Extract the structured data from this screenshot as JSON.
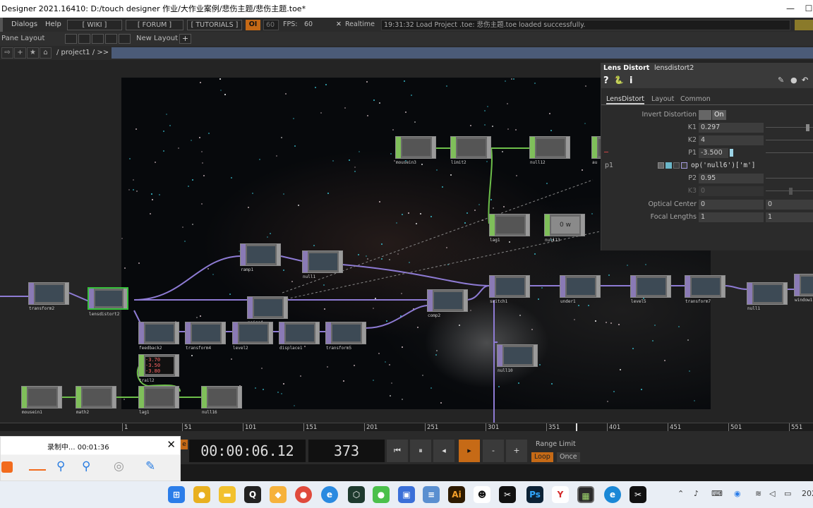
{
  "titlebar": {
    "title": "Designer 2021.16410: D:/touch designer 作业/大作业案例/悲伤主题/悲伤主题.toe*",
    "minimize": "—",
    "maximize": "☐"
  },
  "menubar": {
    "dialogs": "Dialogs",
    "help": "Help",
    "wiki": "[ WIKI ]",
    "forum": "[ FORUM ]",
    "tutorials": "[ TUTORIALS ]",
    "oi": "OI",
    "fps_target": "60",
    "fps_label": "FPS:",
    "fps_value": "60",
    "realtime_check": "✕",
    "realtime": "Realtime",
    "log": "19:31:32 Load Project .toe: 悲伤主题.toe loaded successfully."
  },
  "panebar": {
    "pane_layout": "Pane Layout",
    "new_layout": "New Layout",
    "plus": "+"
  },
  "pathbar": {
    "path": "/ project1 / >>",
    "btn_back": "⇨",
    "btn_add": "+",
    "btn_star": "★",
    "btn_home": "⌂"
  },
  "network": {
    "nodes": [
      {
        "label": "transform2"
      },
      {
        "label": "lensdistort2"
      },
      {
        "label": "ramp1"
      },
      {
        "label": "null1"
      },
      {
        "label": "noise4"
      },
      {
        "label": "comp2"
      },
      {
        "label": "feedback2"
      },
      {
        "label": "transform4"
      },
      {
        "label": "level2"
      },
      {
        "label": "displace1"
      },
      {
        "label": "transform5"
      },
      {
        "label": "switch1"
      },
      {
        "label": "under1"
      },
      {
        "label": "level5"
      },
      {
        "label": "transform7"
      },
      {
        "label": "null1"
      },
      {
        "label": "window1"
      },
      {
        "label": "null10"
      },
      {
        "label": "mousein3"
      },
      {
        "label": "limit2"
      },
      {
        "label": "null12"
      },
      {
        "label": "au"
      },
      {
        "label": "lag1"
      },
      {
        "label": "null13"
      },
      {
        "label": "trail2"
      },
      {
        "label": "mousein1"
      },
      {
        "label": "math2"
      },
      {
        "label": "lag1"
      },
      {
        "label": "null16"
      }
    ],
    "null13_value": "0 w",
    "trail_values": [
      "-3.70",
      "-3.50",
      "-3.80"
    ]
  },
  "params": {
    "op_type": "Lens Distort",
    "op_name": "lensdistort2",
    "icon_help": "?",
    "icon_python": "🐍",
    "icon_info": "i",
    "tabs": [
      "LensDistort",
      "Layout",
      "Common"
    ],
    "invert_label": "Invert Distortion",
    "invert_value": "On",
    "k1_label": "K1",
    "k1_value": "0.297",
    "k2_label": "K2",
    "k2_value": "4",
    "p1_label": "P1",
    "p1_value": "-3.500",
    "p1_expr_label": "p1",
    "p1_expr": "op('null6')['m']",
    "p2_label": "P2",
    "p2_value": "0.95",
    "k3_label": "K3",
    "k3_value": "0",
    "optical_label": "Optical Center",
    "optical_x": "0",
    "optical_y": "0",
    "focal_label": "Focal Lengths",
    "focal_x": "1",
    "focal_y": "1"
  },
  "timeline": {
    "ticks": [
      "1",
      "51",
      "101",
      "151",
      "201",
      "251",
      "301",
      "351",
      "401",
      "451",
      "501",
      "551"
    ]
  },
  "transport": {
    "timecode": "00:00:06.12",
    "frame": "373",
    "btn_start": "⏮",
    "btn_pause": "⏸",
    "btn_back": "◂",
    "btn_play": "▸",
    "btn_minus": "-",
    "btn_plus": "+",
    "range_limit": "Range Limit",
    "loop": "Loop",
    "once": "Once",
    "left_btn": "e"
  },
  "recorder": {
    "status": "录制中... 00:01:36",
    "close": "✕"
  },
  "taskbar": {
    "apps": [
      "windows",
      "chrome-canary",
      "file-explorer",
      "qq",
      "wechat-files",
      "chrome",
      "edge-blue",
      "touchdesigner-dark",
      "wechat",
      "tools",
      "notes",
      "illustrator",
      "panda",
      "capcut",
      "photoshop",
      "yonyou",
      "touchdesigner",
      "edge",
      "capcut-2"
    ],
    "ai_label": "Ai",
    "ps_label": "Ps",
    "y_label": "Y",
    "clock": "202"
  },
  "colors": {
    "accent_orange": "#c66a16",
    "top_operator": "#8a7ab5",
    "chop_operator": "#7fbf5a",
    "wire_purple": "#8e7bd4",
    "wire_green": "#6dbf4a",
    "selected": "#36c13b"
  }
}
